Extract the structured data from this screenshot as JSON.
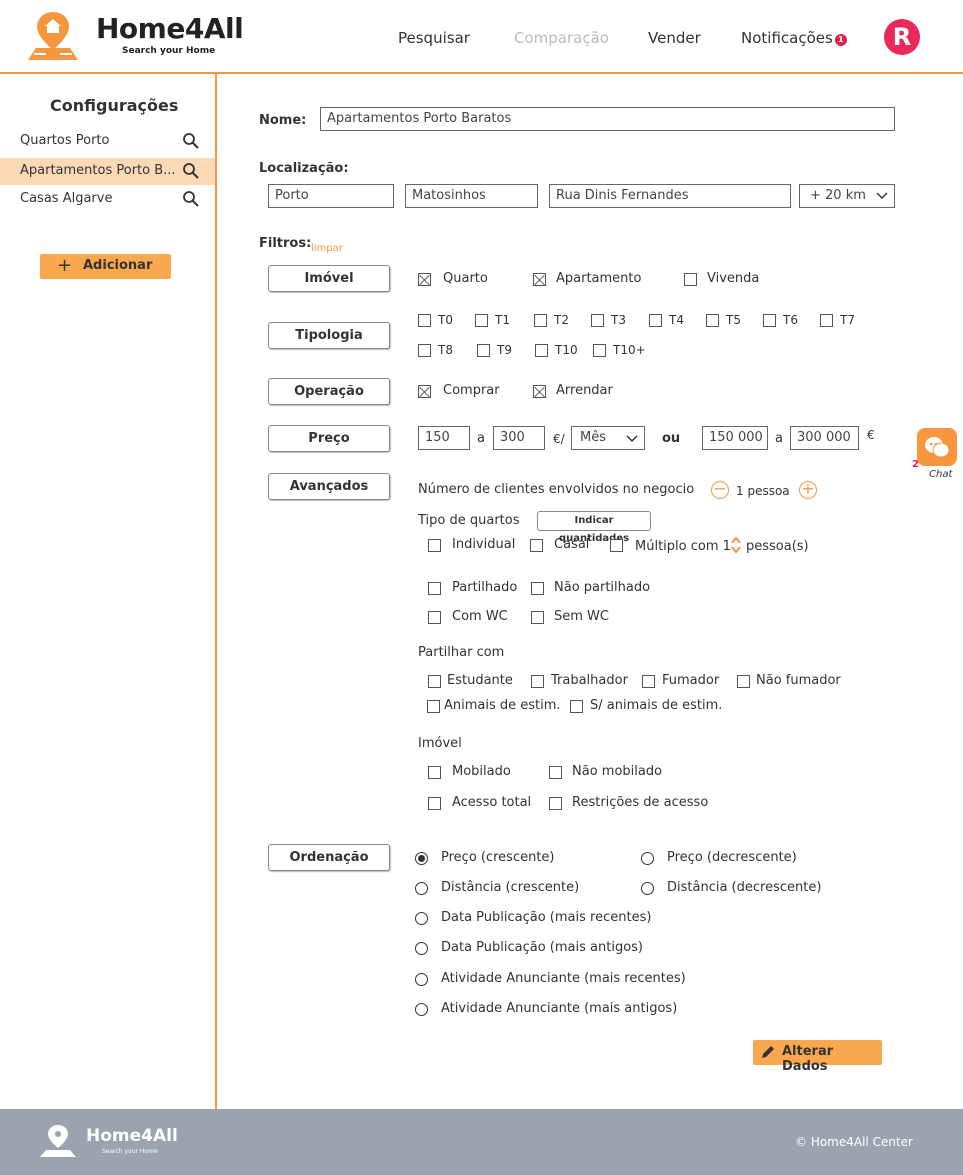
{
  "header": {
    "brand": "Home4All",
    "tagline": "Search your Home",
    "nav": [
      "Pesquisar",
      "Comparação",
      "Vender",
      "Notificações"
    ],
    "notif_count": "1",
    "avatar_letter": "R"
  },
  "sidebar": {
    "title": "Configurações",
    "items": [
      "Quartos Porto",
      "Apartamentos Porto B...",
      "Casas Algarve"
    ],
    "add_label": "Adicionar"
  },
  "form": {
    "name_label": "Nome:",
    "name_value": "Apartamentos Porto Baratos",
    "loc_label": "Localização:",
    "loc_city": "Porto",
    "loc_area": "Matosinhos",
    "loc_street": "Rua Dinis Fernandes",
    "loc_radius": "+ 20 km",
    "filters_label": "Filtros:",
    "clear_label": "limpar",
    "btn_imovel": "Imóvel",
    "btn_tipologia": "Tipologia",
    "btn_operacao": "Operação",
    "btn_preco": "Preço",
    "btn_avancados": "Avançados",
    "btn_ordenacao": "Ordenação",
    "imovel_opts": [
      "Quarto",
      "Apartamento",
      "Vivenda"
    ],
    "tipologia_opts": [
      "T0",
      "T1",
      "T2",
      "T3",
      "T4",
      "T5",
      "T6",
      "T7",
      "T8",
      "T9",
      "T10",
      "T10+"
    ],
    "operacao_opts": [
      "Comprar",
      "Arrendar"
    ],
    "preco": {
      "min1": "150",
      "sep1": "a",
      "max1": "300",
      "unit1": "€/",
      "period": "Mês",
      "or": "ou",
      "min2": "150 000",
      "sep2": "a",
      "max2": "300 000",
      "unit2": "€"
    },
    "adv": {
      "clients_label": "Número de clientes envolvidos no negocio",
      "clients_value": "1 pessoa",
      "room_type_label": "Tipo de quartos",
      "indicate_btn": "Indicar quantidades",
      "room_types": [
        "Individual",
        "Casal",
        "Múltiplo com 1",
        "pessoa(s)"
      ],
      "shared": [
        "Partilhado",
        "Não partilhado"
      ],
      "wc": [
        "Com WC",
        "Sem WC"
      ],
      "share_with_label": "Partilhar com",
      "share_with": [
        "Estudante",
        "Trabalhador",
        "Fumador",
        "Não fumador",
        "Animais de estim.",
        "S/ animais de estim."
      ],
      "property_label": "Imóvel",
      "property": [
        "Mobilado",
        "Não mobilado",
        "Acesso total",
        "Restrições de acesso"
      ]
    },
    "sort": [
      "Preço (crescente)",
      "Preço (decrescente)",
      "Distância (crescente)",
      "Distância (decrescente)",
      "Data Publicação (mais recentes)",
      "Data Publicação (mais antigos)",
      "Atividade Anunciante (mais recentes)",
      "Atividade Anunciante (mais antigos)"
    ],
    "submit": "Alterar Dados"
  },
  "chat": {
    "badge": "2",
    "label": "Chat"
  },
  "footer": {
    "brand": "Home4All",
    "tagline": "Search your Home",
    "copyright": "© Home4All Center"
  },
  "colors": {
    "accent": "#f7963e",
    "avatar": "#e8295a",
    "footer": "#9ca2ae"
  }
}
